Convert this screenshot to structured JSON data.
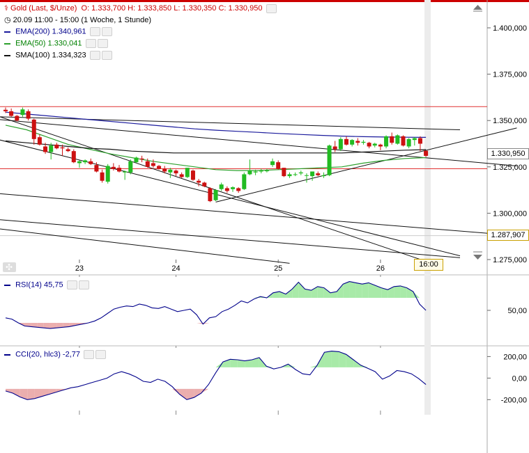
{
  "header": {
    "title": "Gold (Last, $/Unze)",
    "ohlc": "O: 1.333,700  H: 1.333,850  L: 1.330,350  C: 1.330,950",
    "period": "20.09 11:00 - 15:00 (1 Woche, 1 Stunde)"
  },
  "indicators": [
    {
      "label": "EMA(200)",
      "value": "1.340,961",
      "color": "#1a1a9c"
    },
    {
      "label": "EMA(50)",
      "value": "1.330,041",
      "color": "#2ca02c"
    },
    {
      "label": "SMA(100)",
      "value": "1.334,323",
      "color": "#111111"
    }
  ],
  "rsi_panel": {
    "label": "RSI(14)",
    "value": "45,75",
    "tick": "50,00"
  },
  "cci_panel": {
    "label": "CCI(20, hlc3)",
    "value": "-2,77",
    "ticks": [
      "200,00",
      "0,00",
      "-200,00"
    ]
  },
  "price_labels": {
    "current": "1.330,950",
    "level": "1.287,907"
  },
  "time_marker": "16:00",
  "colors": {
    "up": "#22bb22",
    "down": "#cc1111",
    "hline": "#e03030",
    "rsi_fill": "#e8a0a0",
    "rsi_fill_over": "#99e699"
  },
  "chart_data": {
    "type": "candlestick",
    "y_axis": {
      "ticks": [
        "1.400,000",
        "1.375,000",
        "1.350,000",
        "1.325,000",
        "1.300,000",
        "1.275,000"
      ],
      "range": [
        1270,
        1406
      ]
    },
    "x_axis": {
      "ticks": [
        "23",
        "24",
        "25",
        "26"
      ]
    },
    "horizontal_levels": [
      1357.5,
      1324.0
    ],
    "candles": [
      [
        1355.8,
        1357.0,
        1354.0,
        1355.0
      ],
      [
        1355.0,
        1356.5,
        1352.0,
        1352.5
      ],
      [
        1352.5,
        1353.0,
        1349.5,
        1350.0
      ],
      [
        1353.0,
        1357.0,
        1352.0,
        1356.0
      ],
      [
        1355.0,
        1356.0,
        1350.0,
        1351.0
      ],
      [
        1350.5,
        1351.0,
        1337.0,
        1340.0
      ],
      [
        1341.0,
        1342.5,
        1336.5,
        1337.0
      ],
      [
        1336.0,
        1338.0,
        1332.0,
        1333.0
      ],
      [
        1333.0,
        1338.0,
        1329.0,
        1336.5
      ],
      [
        1337.0,
        1338.0,
        1334.5,
        1335.0
      ],
      [
        1335.5,
        1337.0,
        1331.0,
        1335.0
      ],
      [
        1334.5,
        1335.5,
        1333.0,
        1333.5
      ],
      [
        1333.5,
        1334.5,
        1327.0,
        1327.5
      ],
      [
        1327.0,
        1328.5,
        1324.5,
        1328.0
      ],
      [
        1327.5,
        1329.0,
        1326.5,
        1328.5
      ],
      [
        1328.0,
        1329.5,
        1326.0,
        1326.5
      ],
      [
        1326.0,
        1327.5,
        1322.0,
        1322.5
      ],
      [
        1322.0,
        1323.5,
        1316.5,
        1317.5
      ],
      [
        1317.0,
        1326.5,
        1316.0,
        1325.5
      ],
      [
        1325.0,
        1327.0,
        1323.0,
        1324.0
      ],
      [
        1324.5,
        1326.0,
        1322.0,
        1322.5
      ],
      [
        1322.0,
        1323.0,
        1318.0,
        1322.5
      ],
      [
        1322.0,
        1329.0,
        1321.0,
        1328.0
      ],
      [
        1327.5,
        1330.5,
        1327.0,
        1330.0
      ],
      [
        1329.5,
        1331.0,
        1327.5,
        1329.0
      ],
      [
        1328.0,
        1329.5,
        1324.5,
        1325.0
      ],
      [
        1327.0,
        1329.0,
        1324.5,
        1325.5
      ],
      [
        1325.5,
        1326.0,
        1323.5,
        1324.0
      ],
      [
        1324.0,
        1325.5,
        1321.5,
        1322.5
      ],
      [
        1322.0,
        1324.5,
        1319.0,
        1323.5
      ],
      [
        1323.0,
        1323.5,
        1320.0,
        1321.5
      ],
      [
        1321.0,
        1322.0,
        1319.0,
        1319.5
      ],
      [
        1319.5,
        1324.5,
        1319.0,
        1324.5
      ],
      [
        1323.0,
        1323.5,
        1317.5,
        1318.0
      ],
      [
        1317.5,
        1318.5,
        1314.5,
        1316.5
      ],
      [
        1316.5,
        1317.0,
        1314.0,
        1314.5
      ],
      [
        1313.5,
        1314.0,
        1306.0,
        1306.5
      ],
      [
        1307.0,
        1313.0,
        1306.5,
        1312.5
      ],
      [
        1313.0,
        1316.5,
        1312.0,
        1315.5
      ],
      [
        1313.5,
        1314.5,
        1311.0,
        1312.0
      ],
      [
        1313.0,
        1314.5,
        1311.5,
        1314.0
      ],
      [
        1313.5,
        1314.0,
        1311.0,
        1312.0
      ],
      [
        1313.0,
        1322.0,
        1312.5,
        1321.0
      ],
      [
        1321.0,
        1329.0,
        1320.5,
        1323.0
      ],
      [
        1322.0,
        1323.5,
        1320.5,
        1322.5
      ],
      [
        1322.5,
        1324.0,
        1321.5,
        1323.0
      ],
      [
        1323.0,
        1324.0,
        1322.0,
        1323.0
      ],
      [
        1326.0,
        1329.5,
        1325.0,
        1328.0
      ],
      [
        1327.5,
        1328.5,
        1323.5,
        1324.0
      ],
      [
        1324.5,
        1324.5,
        1319.5,
        1320.0
      ],
      [
        1320.0,
        1322.0,
        1319.0,
        1321.0
      ],
      [
        1321.0,
        1322.0,
        1320.0,
        1321.0
      ],
      [
        1321.5,
        1323.0,
        1320.5,
        1322.0
      ],
      [
        1320.5,
        1321.5,
        1316.5,
        1320.5
      ],
      [
        1320.0,
        1322.5,
        1317.5,
        1322.5
      ],
      [
        1321.5,
        1322.5,
        1320.0,
        1320.5
      ],
      [
        1320.0,
        1322.0,
        1319.0,
        1320.5
      ],
      [
        1320.5,
        1337.0,
        1320.0,
        1336.5
      ],
      [
        1336.0,
        1339.0,
        1333.0,
        1334.5
      ],
      [
        1334.5,
        1341.0,
        1333.5,
        1340.0
      ],
      [
        1340.0,
        1341.5,
        1336.5,
        1337.0
      ],
      [
        1337.0,
        1340.0,
        1336.0,
        1339.5
      ],
      [
        1339.0,
        1340.5,
        1336.5,
        1338.0
      ],
      [
        1338.0,
        1339.5,
        1337.0,
        1338.5
      ],
      [
        1338.0,
        1338.5,
        1335.0,
        1336.0
      ],
      [
        1336.5,
        1338.0,
        1335.5,
        1337.5
      ],
      [
        1337.0,
        1337.5,
        1334.0,
        1336.0
      ],
      [
        1336.0,
        1342.0,
        1335.0,
        1341.5
      ],
      [
        1341.5,
        1343.5,
        1337.0,
        1338.0
      ],
      [
        1337.5,
        1342.5,
        1337.0,
        1342.0
      ],
      [
        1341.5,
        1342.0,
        1336.0,
        1336.5
      ],
      [
        1336.0,
        1340.5,
        1335.0,
        1340.0
      ],
      [
        1339.5,
        1341.0,
        1336.5,
        1340.5
      ],
      [
        1340.5,
        1341.5,
        1333.5,
        1337.5
      ],
      [
        1333.7,
        1333.85,
        1330.35,
        1330.95
      ]
    ],
    "ema200": [
      1354.5,
      1353.5,
      1352.5,
      1351.5,
      1350.5,
      1349.5,
      1348.5,
      1347.5,
      1346.5,
      1345.5,
      1344.8,
      1344.2,
      1343.6,
      1343.0,
      1342.5,
      1342.0,
      1341.6,
      1341.3,
      1341.1,
      1341.0,
      1340.9
    ],
    "ema50": [
      1347.5,
      1345.0,
      1341.0,
      1337.0,
      1334.5,
      1332.0,
      1330.0,
      1328.0,
      1326.5,
      1325.0,
      1323.5,
      1323.0,
      1323.0,
      1323.5,
      1324.0,
      1324.5,
      1325.0,
      1327.0,
      1328.5,
      1329.5,
      1330.0
    ],
    "sma100": [
      1339.0,
      1338.0,
      1337.0,
      1336.0,
      1335.0,
      1334.5,
      1333.5,
      1333.0,
      1332.5,
      1332.5,
      1332.5,
      1332.5,
      1332.5,
      1332.5,
      1332.5,
      1332.5,
      1332.5,
      1333.0,
      1333.5,
      1334.0,
      1334.3
    ],
    "trendlines": [
      {
        "from": [
          0,
          1352.0
        ],
        "to": [
          80,
          1345.0
        ]
      },
      {
        "from": [
          0,
          1350.5
        ],
        "to": [
          90,
          1325.5
        ]
      },
      {
        "from": [
          0,
          1339.5
        ],
        "to": [
          80,
          1277.0
        ]
      },
      {
        "from": [
          0,
          1352.0
        ],
        "to": [
          75,
          1273.0
        ]
      },
      {
        "from": [
          37,
          1306.0
        ],
        "to": [
          90,
          1346.0
        ]
      },
      {
        "from": [
          0,
          1310.5
        ],
        "to": [
          90,
          1287.9
        ]
      },
      {
        "from": [
          0,
          1296.5
        ],
        "to": [
          80,
          1276.0
        ]
      },
      {
        "from": [
          0,
          1291.5
        ],
        "to": [
          50,
          1273.0
        ]
      }
    ],
    "rsi": [
      38,
      36,
      30,
      25,
      24,
      23,
      22,
      21,
      22,
      23,
      24,
      26,
      28,
      30,
      33,
      38,
      45,
      52,
      55,
      57,
      56,
      60,
      58,
      54,
      53,
      56,
      52,
      48,
      50,
      52,
      43,
      28,
      38,
      40,
      48,
      52,
      58,
      65,
      62,
      68,
      72,
      70,
      78,
      80,
      76,
      84,
      95,
      84,
      82,
      88,
      86,
      78,
      80,
      92,
      96,
      94,
      92,
      94,
      90,
      86,
      83,
      88,
      89,
      86,
      80,
      60,
      50
    ],
    "cci": [
      -120,
      -140,
      -175,
      -200,
      -190,
      -170,
      -150,
      -130,
      -110,
      -90,
      -80,
      -60,
      -40,
      -20,
      0,
      40,
      60,
      40,
      10,
      -30,
      -40,
      -10,
      -30,
      -80,
      -150,
      -200,
      -180,
      -140,
      -60,
      50,
      150,
      175,
      170,
      160,
      170,
      190,
      110,
      85,
      100,
      130,
      80,
      40,
      30,
      120,
      240,
      250,
      245,
      220,
      170,
      120,
      90,
      60,
      -10,
      20,
      70,
      60,
      40,
      -5,
      -60
    ]
  }
}
